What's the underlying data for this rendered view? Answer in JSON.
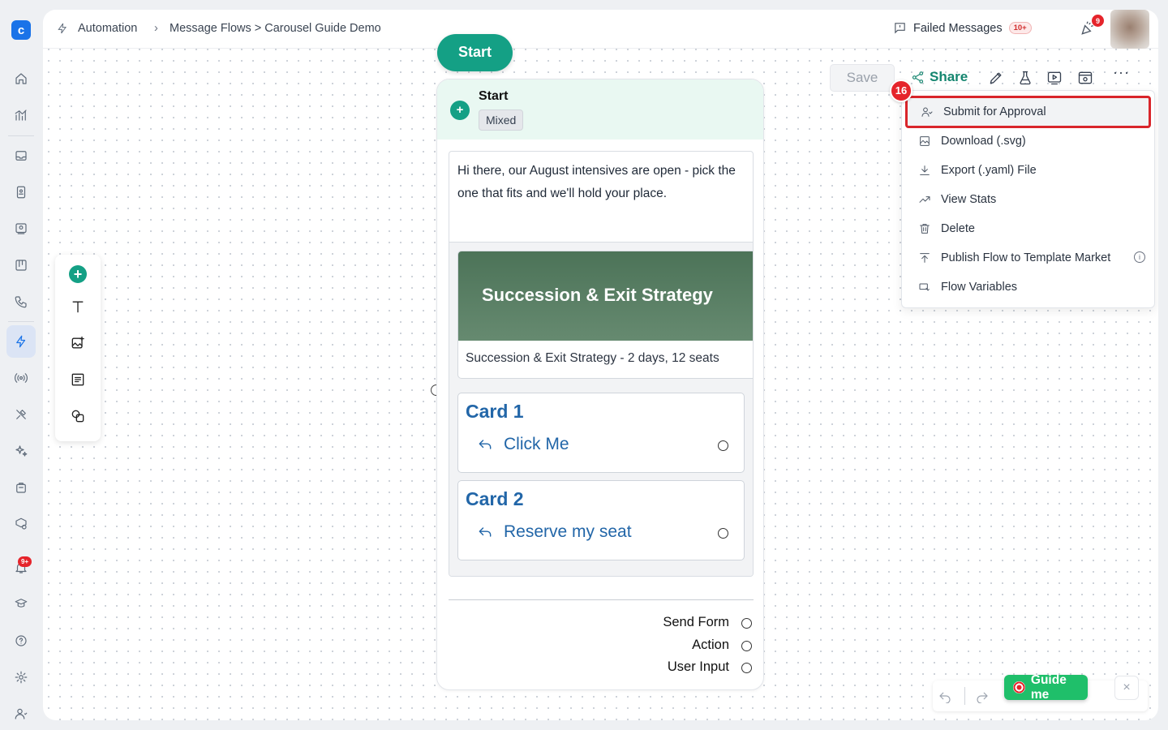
{
  "breadcrumb": {
    "section": "Automation",
    "path": "Message Flows > Carousel Guide Demo"
  },
  "header": {
    "failed_messages_label": "Failed Messages",
    "failed_messages_count": "10+",
    "notifications_count": "9"
  },
  "sidebar": {
    "notifications_badge": "9+",
    "icons": [
      "home-icon",
      "analytics-icon",
      "inbox-icon",
      "contacts-icon",
      "broadcast-icon",
      "board-icon",
      "phone-icon",
      "automation-icon",
      "live-icon",
      "tools-icon",
      "ai-icon",
      "store-icon",
      "integrations-icon",
      "notifications-icon",
      "academy-icon",
      "help-icon",
      "settings-icon",
      "profile-icon"
    ]
  },
  "palette": {
    "items": [
      "add-icon",
      "text-icon",
      "image-icon",
      "form-icon",
      "shapes-icon"
    ]
  },
  "flow": {
    "start_pill": "Start",
    "node": {
      "title": "Start",
      "tag": "Mixed",
      "message": "Hi there, our August intensives are open - pick the one that fits and we'll hold your place.",
      "carousel": {
        "image_title": "Succession & Exit Strategy",
        "caption": "Succession & Exit Strategy - 2 days, 12 seats"
      },
      "cards": [
        {
          "title": "Card 1",
          "reply": "Click Me"
        },
        {
          "title": "Card 2",
          "reply": "Reserve my seat"
        }
      ],
      "outputs": [
        "Send Form",
        "Action",
        "User Input"
      ]
    }
  },
  "toolbar": {
    "save_label": "Save",
    "share_label": "Share",
    "more_label": "···"
  },
  "menu": {
    "step_number": "16",
    "items": [
      "Submit for Approval",
      "Download (.svg)",
      "Export (.yaml) File",
      "View Stats",
      "Delete",
      "Publish Flow to Template Market",
      "Flow Variables"
    ]
  },
  "guide": {
    "label": "Guide me",
    "close": "×"
  }
}
